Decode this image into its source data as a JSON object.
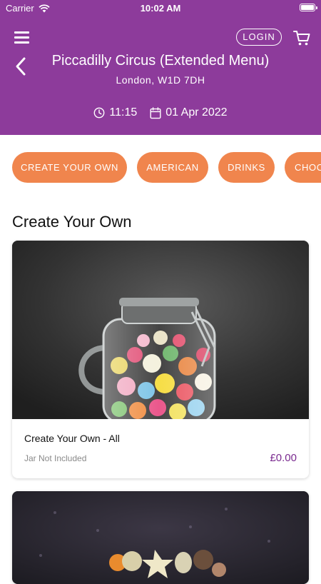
{
  "status": {
    "carrier": "Carrier",
    "time": "10:02 AM"
  },
  "header": {
    "login_label": "LOGIN",
    "title": "Piccadilly Circus (Extended Menu)",
    "subtitle": "London, W1D 7DH",
    "time": "11:15",
    "date": "01 Apr 2022",
    "icons": [
      "menu-icon",
      "cart-icon",
      "back-chevron-icon",
      "clock-icon",
      "calendar-icon"
    ]
  },
  "categories": [
    {
      "label": "CREATE YOUR OWN"
    },
    {
      "label": "AMERICAN"
    },
    {
      "label": "DRINKS"
    },
    {
      "label": "CHOC"
    }
  ],
  "section": {
    "title": "Create Your Own"
  },
  "products": [
    {
      "name": "Create Your Own - All",
      "note": "Jar Not Included",
      "price": "£0.00"
    }
  ],
  "colors": {
    "header_bg": "#8d3b9b",
    "chip_bg": "#f0854d",
    "price": "#7a2a8f"
  }
}
